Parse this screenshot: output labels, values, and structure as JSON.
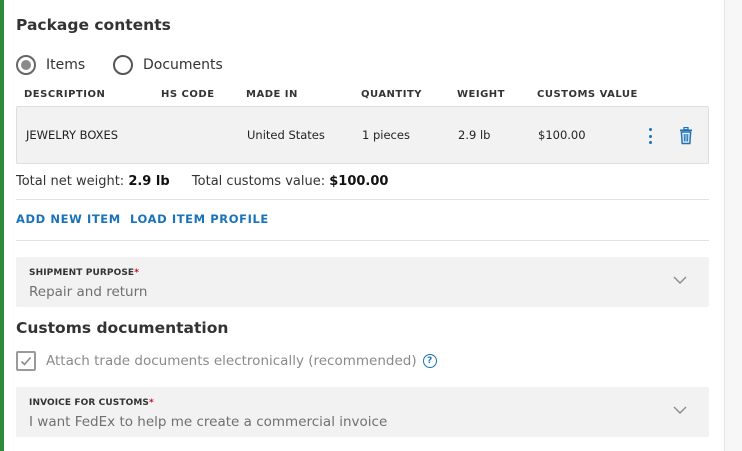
{
  "package": {
    "title": "Package contents",
    "content_type": {
      "options": [
        {
          "label": "Items",
          "selected": true
        },
        {
          "label": "Documents",
          "selected": false
        }
      ]
    },
    "table": {
      "headers": [
        "DESCRIPTION",
        "HS CODE",
        "MADE IN",
        "QUANTITY",
        "WEIGHT",
        "CUSTOMS VALUE"
      ],
      "rows": [
        {
          "description": "JEWELRY BOXES",
          "hs_code": "",
          "made_in": "United States",
          "quantity": "1 pieces",
          "weight": "2.9 lb",
          "customs_value": "$100.00",
          "more_icon": "more-vertical-icon",
          "delete_icon": "trash-icon"
        }
      ]
    },
    "totals": {
      "net_weight_label": "Total net weight:",
      "net_weight_value": "2.9 lb",
      "customs_value_label": "Total customs value:",
      "customs_value_value": "$100.00"
    },
    "links": {
      "add_new_item": "ADD NEW ITEM",
      "load_item_profile": "LOAD ITEM PROFILE"
    }
  },
  "shipment_purpose": {
    "label": "SHIPMENT PURPOSE",
    "required_marker": "*",
    "value": "Repair and return"
  },
  "customs_docs": {
    "title": "Customs documentation",
    "attach_checkbox": {
      "label": "Attach trade documents electronically (recommended)",
      "checked": true,
      "help_icon": "question-circle-icon"
    },
    "invoice": {
      "label": "INVOICE FOR CUSTOMS",
      "required_marker": "*",
      "value": "I want FedEx to help me create a commercial invoice"
    }
  },
  "colors": {
    "accent_green": "#2d8a3a",
    "link_blue": "#1a73b8",
    "required_red": "#c8102e",
    "field_bg": "#f2f2f2"
  }
}
